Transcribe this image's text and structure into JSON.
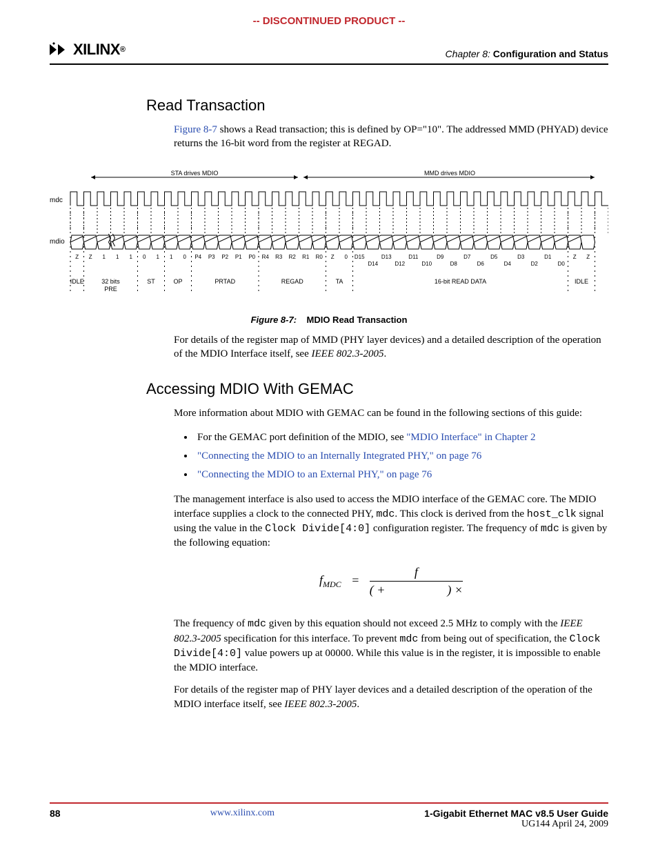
{
  "banner": "-- DISCONTINUED PRODUCT --",
  "header": {
    "logo_text": "XILINX",
    "chapter_prefix": "Chapter 8:",
    "chapter_title": "Configuration and Status"
  },
  "section1": {
    "heading": "Read Transaction",
    "p1_a": "Figure 8-7",
    "p1_b": " shows a Read transaction; this is defined by OP=\"10\". The addressed MMD (PHYAD) device returns the 16-bit word from the register at REGAD."
  },
  "figure": {
    "label": "Figure 8-7:",
    "title": "MDIO Read Transaction",
    "sta_label": "STA drives MDIO",
    "mmd_label": "MMD drives MDIO",
    "mdc": "mdc",
    "mdio": "mdio",
    "bits": [
      "Z",
      "Z",
      "1",
      "1",
      "1",
      "0",
      "1",
      "1",
      "0",
      "P4",
      "P3",
      "P2",
      "P1",
      "P0",
      "R4",
      "R3",
      "R2",
      "R1",
      "R0",
      "Z",
      "0",
      "D15",
      "",
      "D13",
      "",
      "D11",
      "",
      "D9",
      "",
      "D7",
      "",
      "D5",
      "",
      "D3",
      "",
      "D1",
      "",
      "Z",
      "Z"
    ],
    "bits2": [
      "",
      "",
      "",
      "",
      "",
      "",
      "",
      "",
      "",
      "",
      "",
      "",
      "",
      "",
      "",
      "",
      "",
      "",
      "",
      "",
      "",
      "",
      "D14",
      "",
      "D12",
      "",
      "D10",
      "",
      "D8",
      "",
      "D6",
      "",
      "D4",
      "",
      "D2",
      "",
      "D0",
      "",
      ""
    ],
    "segments": [
      "IDLE",
      "32 bits PRE",
      "ST",
      "OP",
      "PRTAD",
      "REGAD",
      "TA",
      "16-bit READ DATA",
      "IDLE"
    ]
  },
  "after_figure": {
    "p1": "For details of the register map of MMD (PHY layer devices) and a detailed description of the operation of the MDIO Interface itself, see ",
    "p1_i": "IEEE 802.3-2005",
    "p1_end": "."
  },
  "section2": {
    "heading": "Accessing MDIO With GEMAC",
    "p1": "More information about MDIO with GEMAC can be found in the following sections of this guide:",
    "bullets": [
      {
        "pre": "For the GEMAC port definition of the MDIO, see ",
        "link": "\"MDIO Interface\" in Chapter 2"
      },
      {
        "pre": "",
        "link": "\"Connecting the MDIO to an Internally Integrated PHY,\" on page 76"
      },
      {
        "pre": "",
        "link": "\"Connecting the MDIO to an External PHY,\" on page 76"
      }
    ],
    "p2_a": "The management interface is also used to access the MDIO interface of the GEMAC core. The MDIO interface supplies a clock to the connected PHY, ",
    "p2_m1": "mdc",
    "p2_b": ". This clock is derived from the ",
    "p2_m2": "host_clk",
    "p2_c": " signal using the value in the ",
    "p2_m3": "Clock Divide[4:0]",
    "p2_d": " configuration register. The frequency of ",
    "p2_m4": "mdc",
    "p2_e": " is given by the following equation:",
    "eq_lhs": "f",
    "eq_lhs_sub": "MDC",
    "eq_num": "f",
    "eq_den_a": "(   +",
    "eq_den_b": ") ×",
    "p3_a": "The frequency of ",
    "p3_m1": "mdc",
    "p3_b": " given by this equation should not exceed 2.5 MHz to comply with the ",
    "p3_i": "IEEE 802.3-2005",
    "p3_c": " specification for this interface. To prevent ",
    "p3_m2": "mdc",
    "p3_d": " from being out of specification, the ",
    "p3_m3": "Clock Divide[4:0]",
    "p3_e": " value powers up at 00000. While this value is in the register, it is impossible to enable the MDIO interface.",
    "p4_a": "For details of the register map of PHY layer devices and a detailed description of the operation of the MDIO interface itself, see ",
    "p4_i": "IEEE 802.3-2005",
    "p4_b": "."
  },
  "footer": {
    "page": "88",
    "url": "www.xilinx.com",
    "doc_title": "1-Gigabit Ethernet MAC v8.5 User Guide",
    "doc_sub": "UG144 April 24, 2009"
  }
}
